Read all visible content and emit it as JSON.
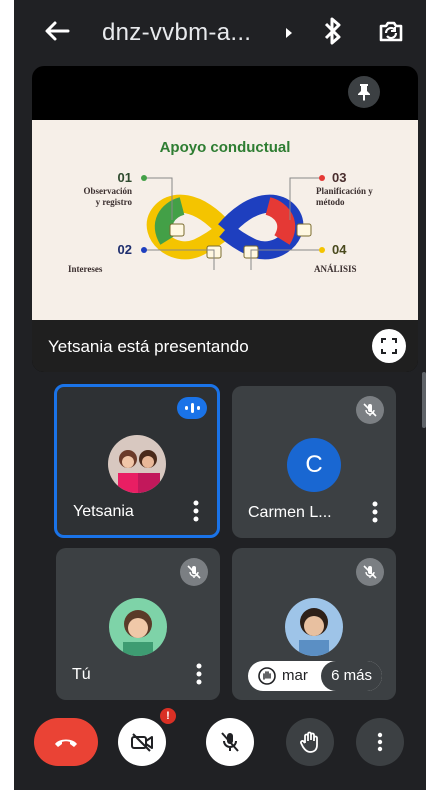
{
  "header": {
    "meeting_code": "dnz-vvbm-a..."
  },
  "slide": {
    "title": "Apoyo conductual",
    "items": [
      {
        "num": "01",
        "label_line1": "Observación",
        "label_line2": "y registro"
      },
      {
        "num": "02",
        "label_line1": "Intereses",
        "label_line2": ""
      },
      {
        "num": "03",
        "label_line1": "Planificación y",
        "label_line2": "método"
      },
      {
        "num": "04",
        "label_line1": "ANÁLISIS",
        "label_line2": ""
      }
    ]
  },
  "presentation": {
    "presenter_text": "Yetsania está presentando"
  },
  "participants": [
    {
      "name": "Yetsania",
      "status": "speaking"
    },
    {
      "name": "Carmen L...",
      "initial": "C",
      "status": "muted"
    },
    {
      "name": "Tú",
      "status": "muted"
    },
    {
      "name": "mar",
      "status": "muted",
      "more_label": "6 más"
    }
  ],
  "controls": {
    "camera_notification": "!"
  },
  "colors": {
    "background": "#202124",
    "tile": "#3c4043",
    "accent": "#1a73e8",
    "end_call": "#ea4335",
    "slide_bg": "#f6efe8",
    "slide_title": "#2e7d32"
  },
  "icons": [
    "back-arrow-icon",
    "chevron-right-icon",
    "bluetooth-icon",
    "switch-camera-icon",
    "pin-icon",
    "fullscreen-icon",
    "mic-off-icon",
    "more-vert-icon",
    "end-call-icon",
    "camera-off-icon",
    "raise-hand-icon"
  ]
}
